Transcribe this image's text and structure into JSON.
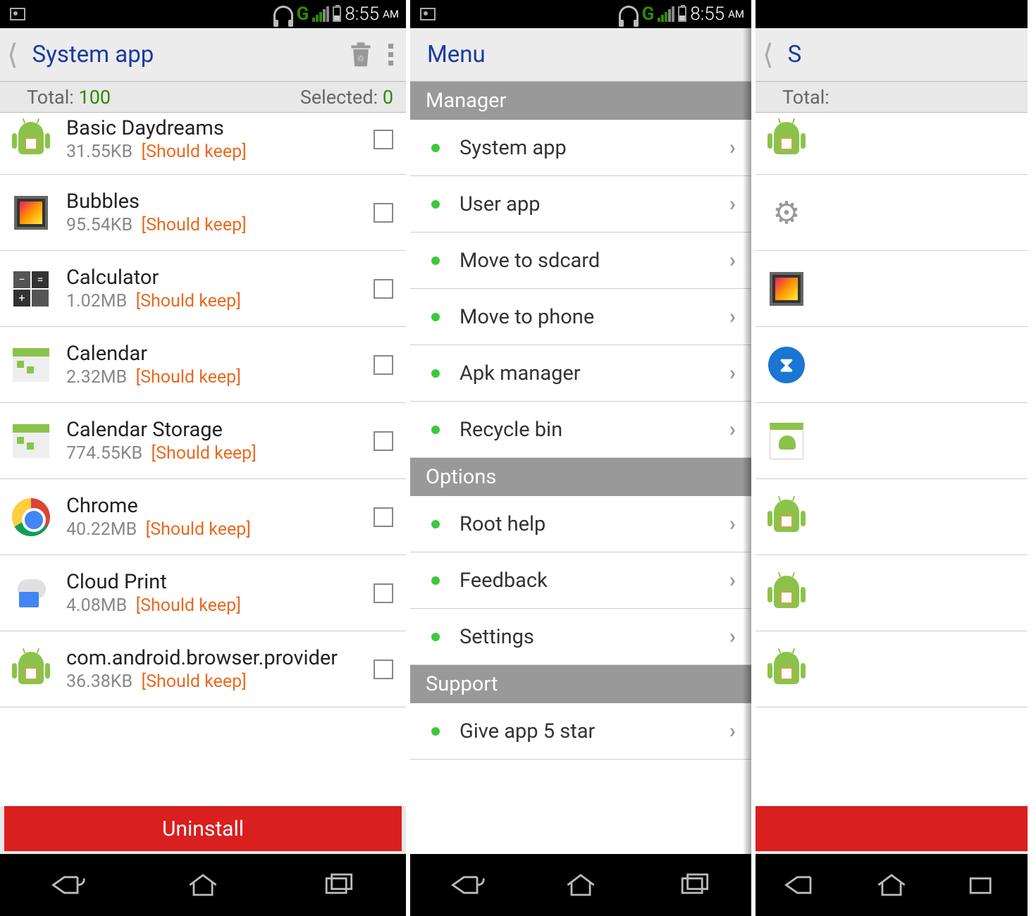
{
  "status": {
    "time": "8:55",
    "ampm": "AM",
    "network": "G"
  },
  "screen1": {
    "title": "System app",
    "total_label": "Total: ",
    "total_value": "100",
    "selected_label": "Selected: ",
    "selected_value": "0",
    "uninstall": "Uninstall",
    "apps": [
      {
        "name": "Basic Daydreams",
        "size": "31.55KB",
        "tag": "[Should keep]",
        "icon": "android-box"
      },
      {
        "name": "Bubbles",
        "size": "95.54KB",
        "tag": "[Should keep]",
        "icon": "photo"
      },
      {
        "name": "Calculator",
        "size": "1.02MB",
        "tag": "[Should keep]",
        "icon": "calc"
      },
      {
        "name": "Calendar",
        "size": "2.32MB",
        "tag": "[Should keep]",
        "icon": "calendar"
      },
      {
        "name": "Calendar Storage",
        "size": "774.55KB",
        "tag": "[Should keep]",
        "icon": "calendar"
      },
      {
        "name": "Chrome",
        "size": "40.22MB",
        "tag": "[Should keep]",
        "icon": "chrome"
      },
      {
        "name": "Cloud Print",
        "size": "4.08MB",
        "tag": "[Should keep]",
        "icon": "cloud"
      },
      {
        "name": "com.android.browser.provider",
        "size": "36.38KB",
        "tag": "[Should keep]",
        "icon": "android-box"
      }
    ]
  },
  "screen2": {
    "title": "Menu",
    "sections": [
      {
        "header": "Manager",
        "items": [
          "System app",
          "User app",
          "Move to sdcard",
          "Move to phone",
          "Apk manager",
          "Recycle bin"
        ]
      },
      {
        "header": "Options",
        "items": [
          "Root help",
          "Feedback",
          "Settings"
        ]
      },
      {
        "header": "Support",
        "items": [
          "Give app 5 star"
        ]
      }
    ]
  },
  "screen3": {
    "title_partial": "S",
    "total_label": "Total:",
    "icons": [
      "android-box",
      "gear",
      "photo",
      "bluetooth",
      "android-file",
      "android-box",
      "android-box",
      "android-box"
    ]
  }
}
